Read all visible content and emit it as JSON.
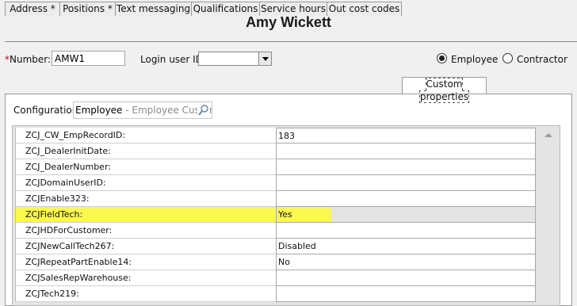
{
  "header": {
    "title": "Amy Wickett"
  },
  "form": {
    "number_required": "*",
    "number_label": "Number:",
    "number_value": "AMW1",
    "login_label": "Login user ID:",
    "login_value": "",
    "radio_employee": "Employee",
    "radio_contractor": "Contractor",
    "selected_type": "Employee"
  },
  "tabs": [
    {
      "label": "Address *"
    },
    {
      "label": "Positions *"
    },
    {
      "label": "Text messaging"
    },
    {
      "label": "Qualifications"
    },
    {
      "label": "Service hours"
    },
    {
      "label": "Out cost codes"
    },
    {
      "label": "Custom properties",
      "active": true
    }
  ],
  "config": {
    "label": "Configuration:",
    "value": "Employee",
    "value_desc": " - Employee Custom Pr",
    "search_icon": "magnifier-icon"
  },
  "properties": [
    {
      "name": "ZCJ_CW_EmpRecordID:",
      "value": "183"
    },
    {
      "name": "ZCJ_DealerInitDate:",
      "value": ""
    },
    {
      "name": "ZCJ_DealerNumber:",
      "value": ""
    },
    {
      "name": "ZCJDomainUserID:",
      "value": ""
    },
    {
      "name": "ZCJEnable323:",
      "value": ""
    },
    {
      "name": "ZCJFieldTech:",
      "value": "Yes",
      "highlighted": true
    },
    {
      "name": "ZCJHDForCustomer:",
      "value": ""
    },
    {
      "name": "ZCJNewCallTech267:",
      "value": "Disabled"
    },
    {
      "name": "ZCJRepeatPartEnable14:",
      "value": "No"
    },
    {
      "name": "ZCJSalesRepWarehouse:",
      "value": ""
    },
    {
      "name": "ZCJTech219:",
      "value": ""
    }
  ],
  "colors": {
    "highlight": "#fffb35",
    "required": "#d00000"
  }
}
